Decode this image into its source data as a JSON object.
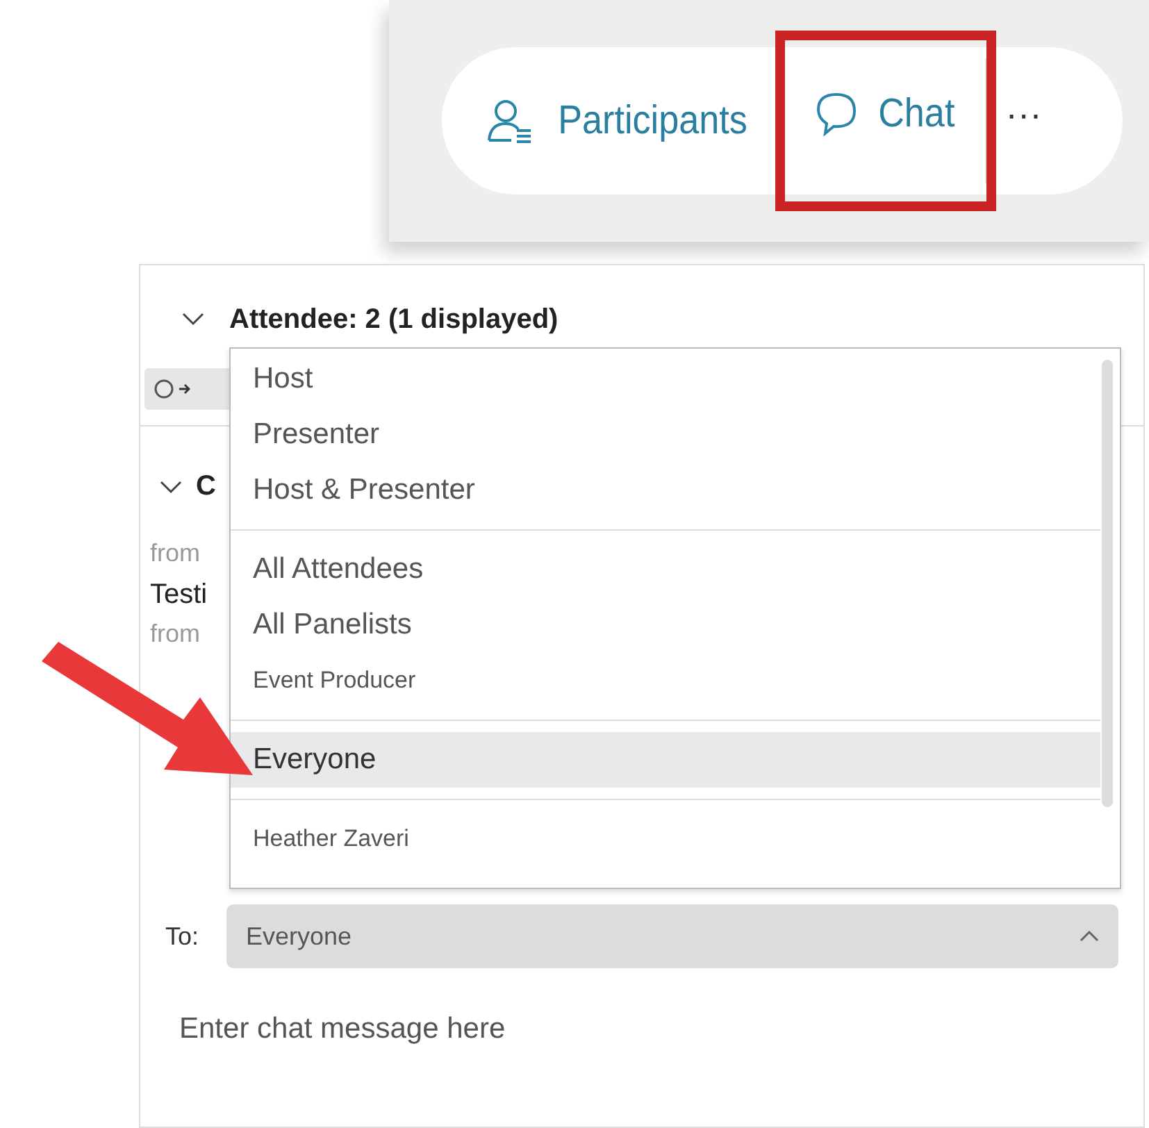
{
  "toolbar": {
    "buttons": [
      {
        "kind": "participants",
        "label": "Participants",
        "highlighted": false
      },
      {
        "kind": "chat",
        "label": "Chat",
        "highlighted": true
      }
    ],
    "more": "···"
  },
  "panel": {
    "attendee_header": {
      "label": "Attendee: 2 (1 displayed)",
      "expanded": true
    },
    "chat_header": {
      "label": "C",
      "expanded": true
    },
    "messages": [
      {
        "kind": "meta",
        "text": "from"
      },
      {
        "kind": "body",
        "text": "Testi"
      },
      {
        "kind": "meta",
        "text": "from"
      }
    ],
    "dropdown": {
      "groups": [
        [
          {
            "kind": "primary",
            "label": "Host",
            "selected": false
          },
          {
            "kind": "primary",
            "label": "Presenter",
            "selected": false
          },
          {
            "kind": "primary",
            "label": "Host & Presenter",
            "selected": false
          }
        ],
        [
          {
            "kind": "primary",
            "label": "All Attendees",
            "selected": false
          },
          {
            "kind": "primary",
            "label": "All Panelists",
            "selected": false
          },
          {
            "kind": "secondary",
            "label": "Event Producer",
            "selected": false
          }
        ],
        [
          {
            "kind": "primary",
            "label": "Everyone",
            "selected": true
          }
        ],
        [
          {
            "kind": "secondary",
            "label": "Heather Zaveri",
            "selected": false
          }
        ]
      ]
    },
    "to": {
      "label": "To:",
      "value": "Everyone"
    },
    "message_input": {
      "placeholder": "Enter chat message here"
    }
  }
}
